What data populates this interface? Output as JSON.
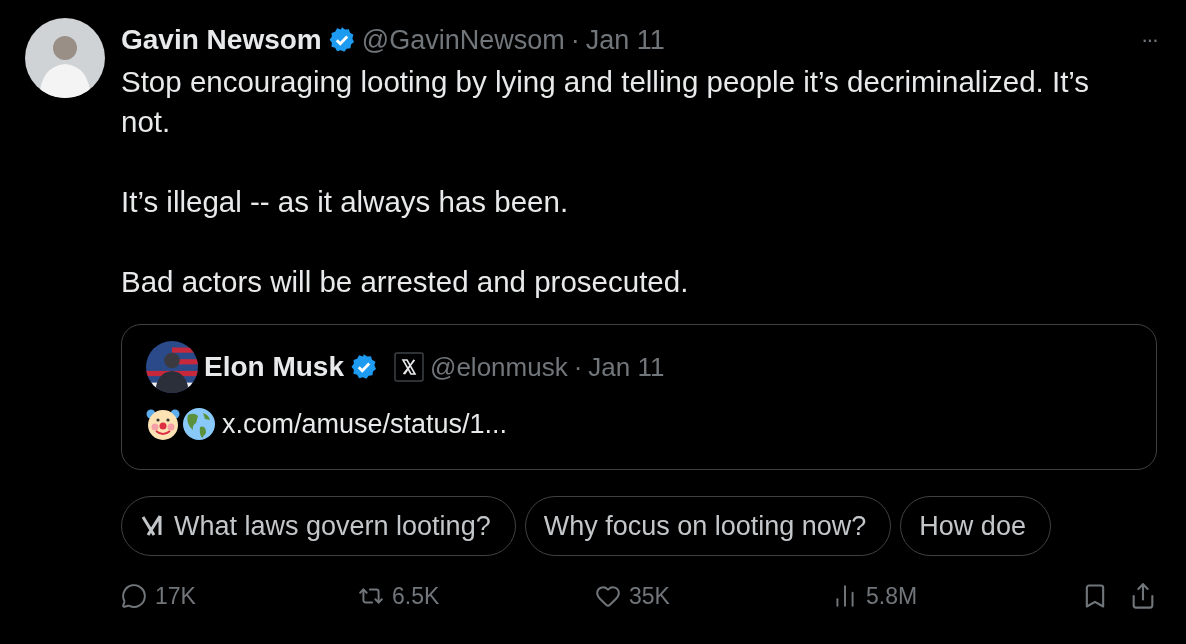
{
  "post": {
    "author": "Gavin Newsom",
    "verified": true,
    "handle": "@GavinNewsom",
    "separator": "·",
    "date": "Jan 11",
    "more": "···",
    "paragraphs": [
      "Stop encouraging looting by lying and telling people it’s decriminalized. It’s not.",
      "It’s illegal -- as it always has been.",
      "Bad actors will be arrested and prosecuted."
    ],
    "quote": {
      "author": "Elon Musk",
      "verified": true,
      "handle": "@elonmusk",
      "separator": "·",
      "date": "Jan 11",
      "link": "x.com/amuse/status/1..."
    },
    "suggestions": [
      {
        "label": "What laws govern looting?",
        "grok": true
      },
      {
        "label": "Why focus on looting now?",
        "grok": false
      },
      {
        "label": "How doe",
        "grok": false
      }
    ],
    "actions": [
      {
        "kind": "reply",
        "count": "17K"
      },
      {
        "kind": "repost",
        "count": "6.5K"
      },
      {
        "kind": "like",
        "count": "35K"
      },
      {
        "kind": "views",
        "count": "5.8M"
      }
    ]
  }
}
